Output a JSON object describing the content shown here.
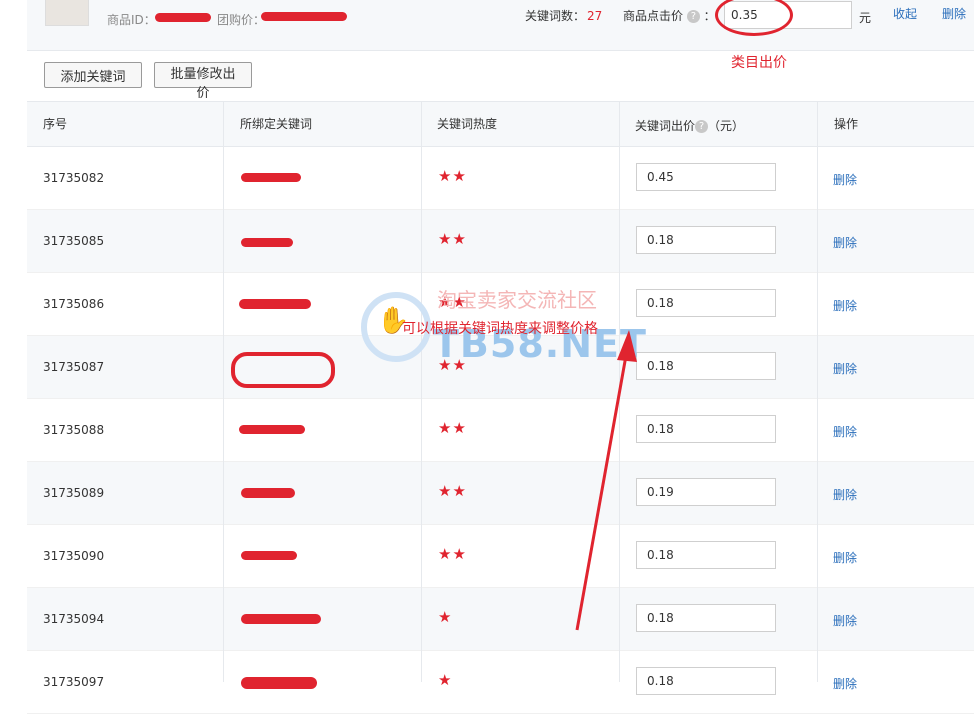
{
  "topbar": {
    "product_id_label": "商品ID：",
    "group_price_label": "团购价：",
    "keyword_count_label": "关键词数：",
    "keyword_count_value": "27",
    "click_price_label": "商品点击价",
    "click_price_colon": "：",
    "click_price_value": "0.35",
    "unit": "元",
    "collapse_label": "收起",
    "delete_label": "删除",
    "category_note": "类目出价"
  },
  "toolbar": {
    "add_keyword_label": "添加关键词",
    "batch_edit_label": "批量修改出价"
  },
  "table": {
    "headers": {
      "seq": "序号",
      "keyword": "所绑定关键词",
      "heat": "关键词热度",
      "bid": "关键词出价",
      "bid_unit": "（元）",
      "op": "操作"
    },
    "rows": [
      {
        "seq": "31735082",
        "heat": "★★",
        "bid": "0.45",
        "op": "删除"
      },
      {
        "seq": "31735085",
        "heat": "★★",
        "bid": "0.18",
        "op": "删除"
      },
      {
        "seq": "31735086",
        "heat": "★★",
        "bid": "0.18",
        "op": "删除"
      },
      {
        "seq": "31735087",
        "heat": "★★",
        "bid": "0.18",
        "op": "删除"
      },
      {
        "seq": "31735088",
        "heat": "★★",
        "bid": "0.18",
        "op": "删除"
      },
      {
        "seq": "31735089",
        "heat": "★★",
        "bid": "0.19",
        "op": "删除"
      },
      {
        "seq": "31735090",
        "heat": "★★",
        "bid": "0.18",
        "op": "删除"
      },
      {
        "seq": "31735094",
        "heat": "★",
        "bid": "0.18",
        "op": "删除"
      },
      {
        "seq": "31735097",
        "heat": "★",
        "bid": "0.18",
        "op": "删除"
      }
    ]
  },
  "annotation": {
    "text": "可以根据关键词热度来调整价格"
  },
  "watermark": {
    "top_text": "淘宝卖家交流社区",
    "brand": "TB58.NET"
  },
  "colors": {
    "accent_red": "#e0242f",
    "link_blue": "#2a6ebb",
    "header_bg": "#f6f8fa"
  }
}
